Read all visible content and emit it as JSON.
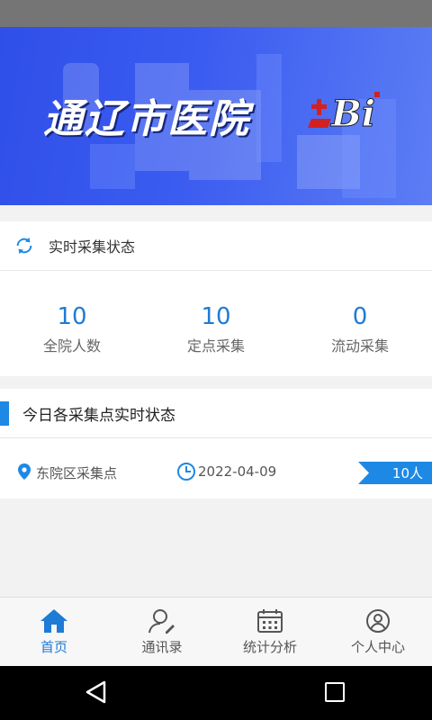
{
  "banner": {
    "title": "通辽市医院",
    "logo_text": "Bi"
  },
  "realtime": {
    "title": "实时采集状态",
    "stats": [
      {
        "value": "10",
        "label": "全院人数"
      },
      {
        "value": "10",
        "label": "定点采集"
      },
      {
        "value": "0",
        "label": "流动采集"
      }
    ]
  },
  "points": {
    "title": "今日各采集点实时状态",
    "rows": [
      {
        "name": "东院区采集点",
        "date": "2022-04-09",
        "count": "10人"
      }
    ]
  },
  "tabs": [
    {
      "label": "首页",
      "icon": "home-icon"
    },
    {
      "label": "通讯录",
      "icon": "contacts-icon"
    },
    {
      "label": "统计分析",
      "icon": "calendar-icon"
    },
    {
      "label": "个人中心",
      "icon": "user-icon"
    }
  ],
  "colors": {
    "accent": "#1e88e5",
    "banner": "#3b5cf0",
    "number": "#1e7bd6"
  }
}
